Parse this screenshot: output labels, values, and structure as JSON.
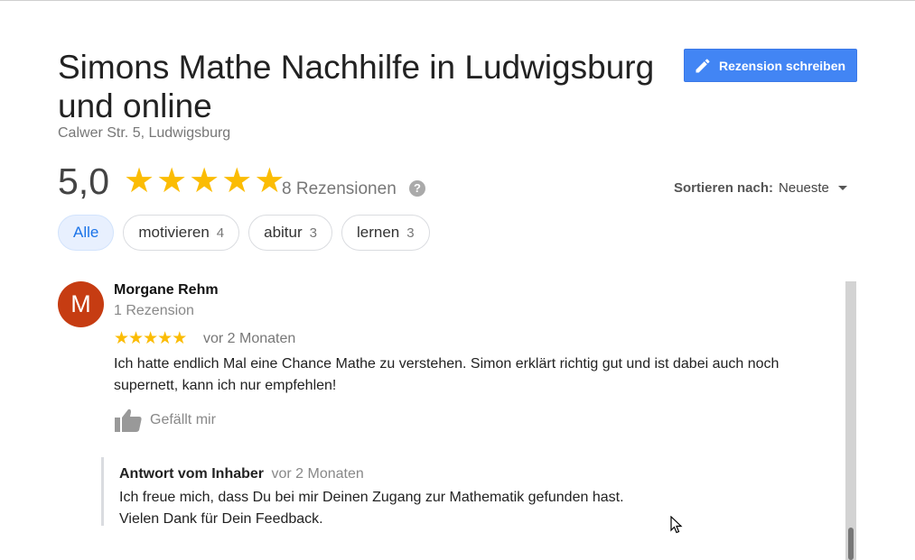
{
  "business": {
    "title": "Simons Mathe Nachhilfe in Ludwigsburg und online",
    "address": "Calwer Str. 5, Ludwigsburg"
  },
  "toolbar": {
    "write_review_label": "Rezension schreiben",
    "write_icon": "pencil-icon"
  },
  "summary": {
    "rating": "5,0",
    "stars": 5,
    "review_count": "8 Rezensionen",
    "help_icon": "?"
  },
  "sort": {
    "label": "Sortieren nach:",
    "value": "Neueste"
  },
  "filters": [
    {
      "label": "Alle",
      "count": ""
    },
    {
      "label": "motivieren",
      "count": "4"
    },
    {
      "label": "abitur",
      "count": "3"
    },
    {
      "label": "lernen",
      "count": "3"
    }
  ],
  "review": {
    "avatar_letter": "M",
    "author": "Morgane Rehm",
    "author_meta": "1 Rezension",
    "stars": 5,
    "date": "vor 2 Monaten",
    "text": "Ich hatte endlich Mal eine Chance Mathe zu verstehen. Simon erklärt richtig gut und ist dabei auch noch supernett, kann ich nur empfehlen!",
    "like_label": "Gefällt mir",
    "owner_reply": {
      "title": "Antwort vom Inhaber",
      "date": "vor 2 Monaten",
      "text": "Ich freue mich, dass Du bei mir Deinen Zugang zur Mathematik gefunden hast.\nVielen Dank für Dein Feedback."
    }
  },
  "colors": {
    "accent": "#4285f4",
    "star": "#fbbc04",
    "avatar": "#c63c12",
    "chip_active_bg": "#e8f0fe"
  }
}
